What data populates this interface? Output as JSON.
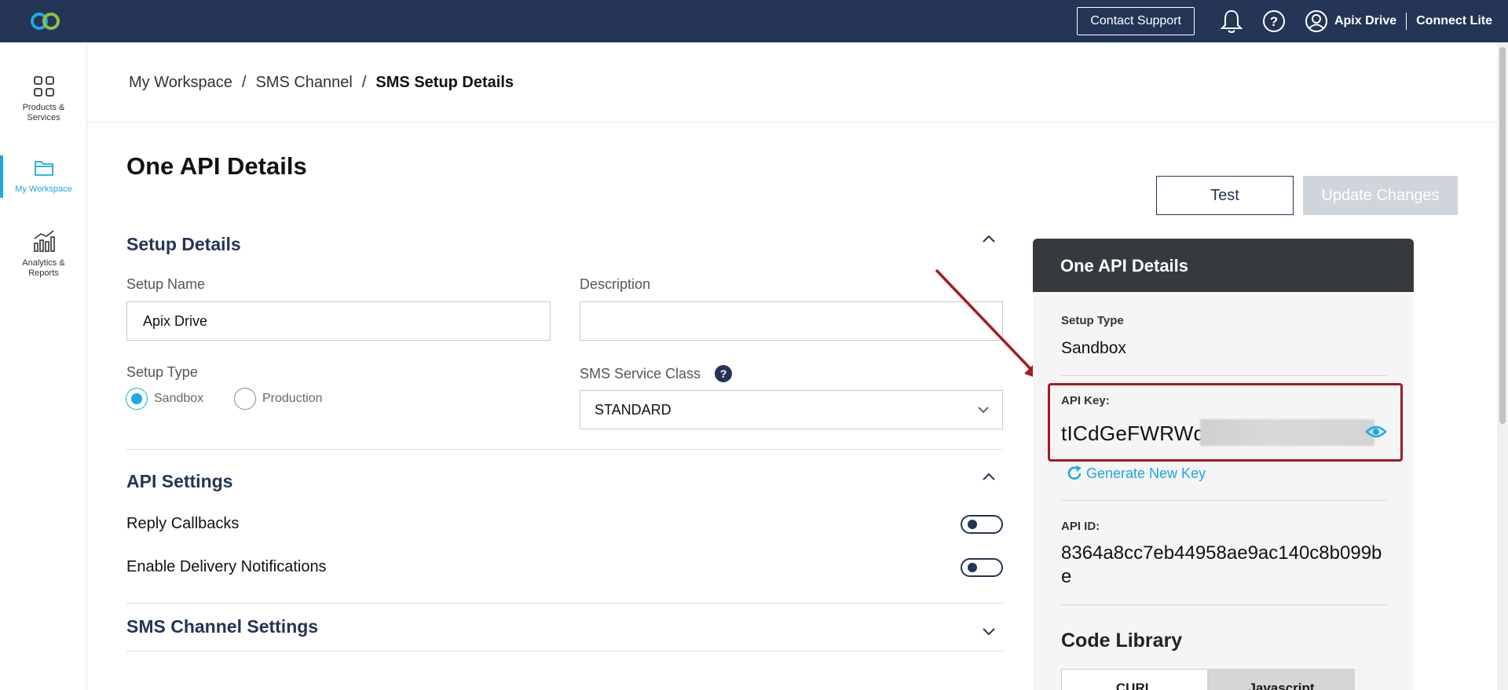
{
  "topbar": {
    "contact_support": "Contact Support",
    "user_name": "Apix Drive",
    "app_name": "Connect Lite"
  },
  "sidebar": {
    "items": [
      {
        "label_line1": "Products &",
        "label_line2": "Services",
        "icon": "grid-icon"
      },
      {
        "label_line1": "My Workspace",
        "label_line2": "",
        "icon": "folder-icon"
      },
      {
        "label_line1": "Analytics &",
        "label_line2": "Reports",
        "icon": "analytics-icon"
      }
    ]
  },
  "breadcrumb": {
    "items": [
      "My Workspace",
      "SMS Channel",
      "SMS Setup Details"
    ],
    "separator": "/"
  },
  "page": {
    "title": "One API Details",
    "test_label": "Test",
    "update_label": "Update Changes"
  },
  "setup": {
    "title": "Setup Details",
    "name_label": "Setup Name",
    "name_value": "Apix Drive",
    "description_label": "Description",
    "description_value": "",
    "type_label": "Setup Type",
    "type_options": [
      "Sandbox",
      "Production"
    ],
    "type_selected": "Sandbox",
    "service_class_label": "SMS Service Class",
    "help_glyph": "?",
    "service_class_value": "STANDARD"
  },
  "api_settings": {
    "title": "API Settings",
    "reply_callbacks": "Reply Callbacks",
    "delivery_notifications": "Enable Delivery Notifications"
  },
  "sms_channel": {
    "title": "SMS Channel Settings"
  },
  "panel": {
    "title": "One API Details",
    "setup_type_label": "Setup Type",
    "setup_type_value": "Sandbox",
    "api_key_label": "API Key:",
    "api_key_value": "tICdGeFWRWq",
    "generate_label": "Generate New Key",
    "api_id_label": "API ID:",
    "api_id_value": "8364a8cc7eb44958ae9ac140c8b099be",
    "code_library_title": "Code Library",
    "code_tabs": [
      "CURL",
      "Javascript"
    ]
  },
  "colors": {
    "navy": "#243556",
    "accent": "#1ea7e0",
    "highlight": "#a31b24",
    "panel_head": "#36393d"
  }
}
